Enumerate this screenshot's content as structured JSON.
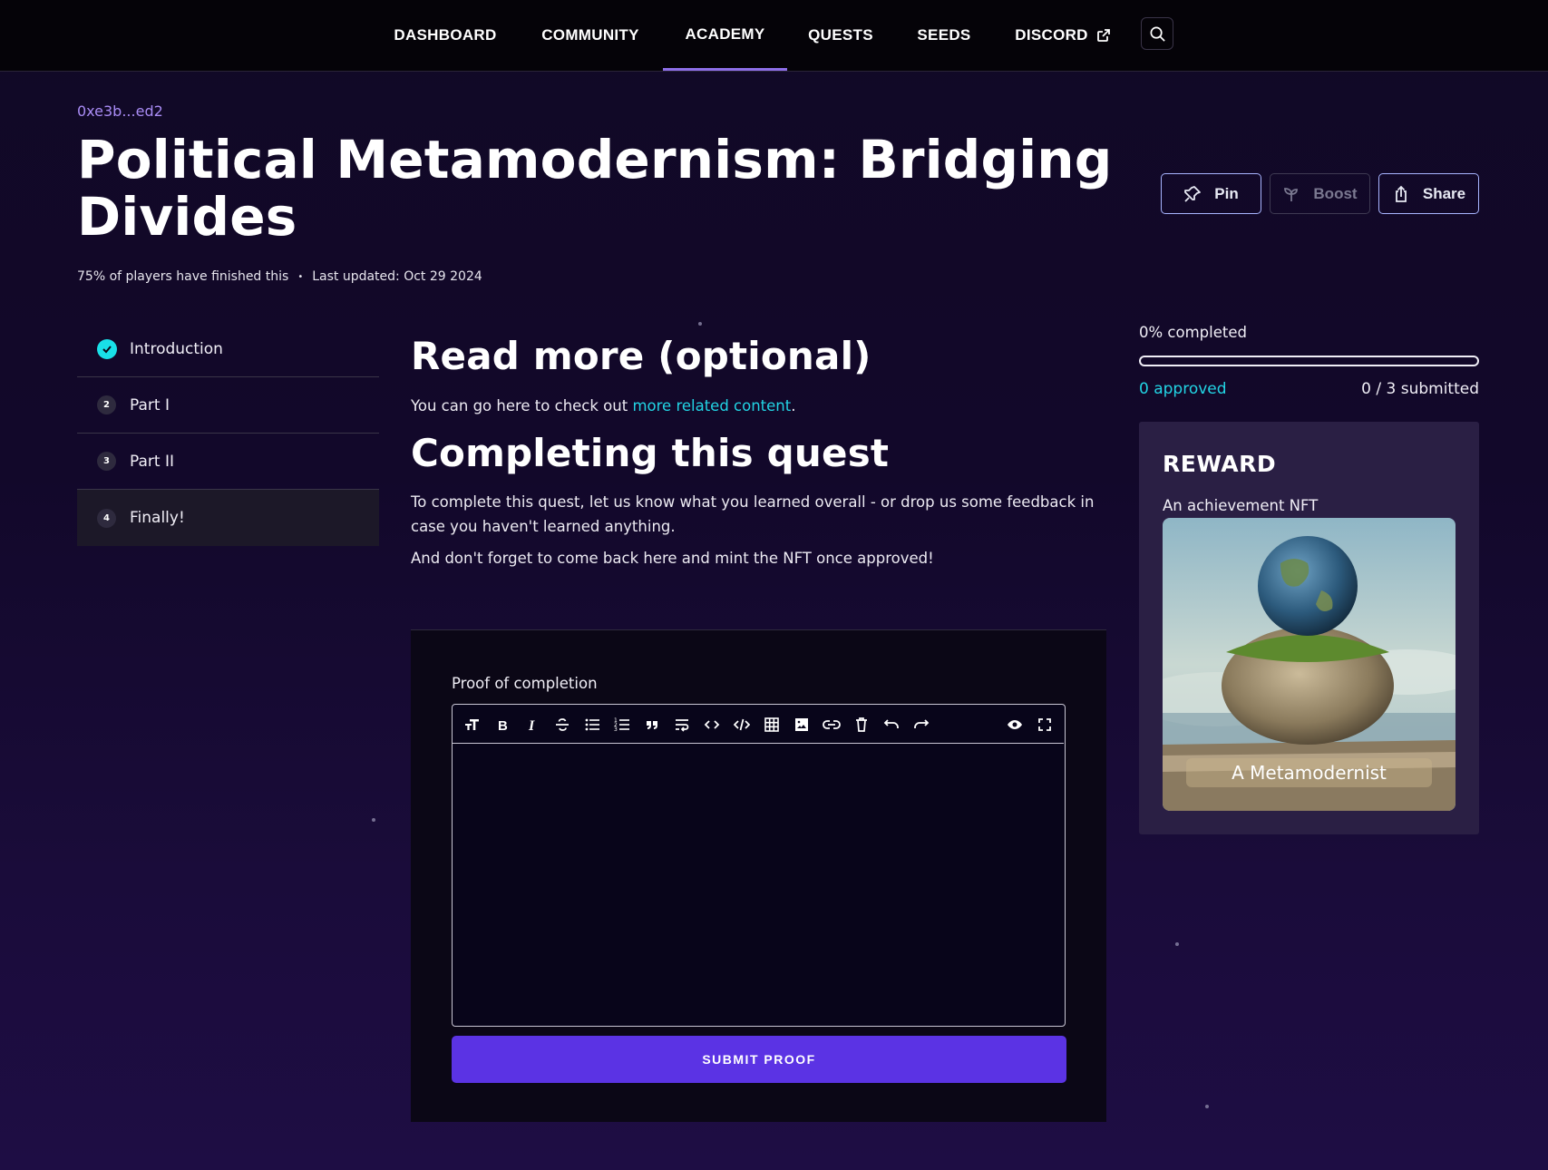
{
  "nav": {
    "items": [
      {
        "label": "DASHBOARD",
        "active": false
      },
      {
        "label": "COMMUNITY",
        "active": false
      },
      {
        "label": "ACADEMY",
        "active": true
      },
      {
        "label": "QUESTS",
        "active": false
      },
      {
        "label": "SEEDS",
        "active": false
      },
      {
        "label": "DISCORD",
        "active": false,
        "icon": "external-link-icon"
      }
    ],
    "search_icon": "search-icon"
  },
  "header": {
    "address": "0xe3b...ed2",
    "title": "Political Metamodernism: Bridging Divides",
    "meta_players": "75% of players have finished this",
    "meta_separator": "•",
    "meta_updated": "Last updated: Oct 29 2024",
    "actions": {
      "pin": "Pin",
      "boost": "Boost",
      "share": "Share"
    }
  },
  "steps": [
    {
      "marker": "check-icon",
      "label": "Introduction"
    },
    {
      "marker": "2",
      "label": "Part I"
    },
    {
      "marker": "3",
      "label": "Part II"
    },
    {
      "marker": "4",
      "label": "Finally!"
    }
  ],
  "content": {
    "read_more_heading": "Read more (optional)",
    "read_more_text_before": "You can go here to check out ",
    "read_more_link": "more related content",
    "read_more_text_after": ".",
    "completing_heading": "Completing this quest",
    "completing_p1": "To complete this quest, let us know what you learned overall - or drop us some feedback in case you haven't learned anything.",
    "completing_p2": "And don't forget to come back here and mint the NFT once approved!"
  },
  "proof": {
    "label": "Proof of completion",
    "editor_value": "",
    "toolbar_icons": [
      "heading-icon",
      "bold-icon",
      "italic-icon",
      "strikethrough-icon",
      "bullet-list-icon",
      "ordered-list-icon",
      "quote-icon",
      "line-break-icon",
      "code-icon",
      "code-block-icon",
      "table-icon",
      "image-icon",
      "link-icon",
      "clear-icon",
      "undo-icon",
      "redo-icon",
      "preview-icon",
      "fullscreen-icon"
    ],
    "submit_label": "SUBMIT PROOF"
  },
  "progress": {
    "percent_label": "0% completed",
    "percent": 0,
    "approved": "0 approved",
    "submitted": "0 / 3 submitted"
  },
  "reward": {
    "title": "REWARD",
    "subtitle": "An achievement NFT",
    "nft_name": "A Metamodernist"
  },
  "colors": {
    "accent": "#5b33e4",
    "cyan": "#22d4e4",
    "nav_active": "#8d6ee8"
  }
}
